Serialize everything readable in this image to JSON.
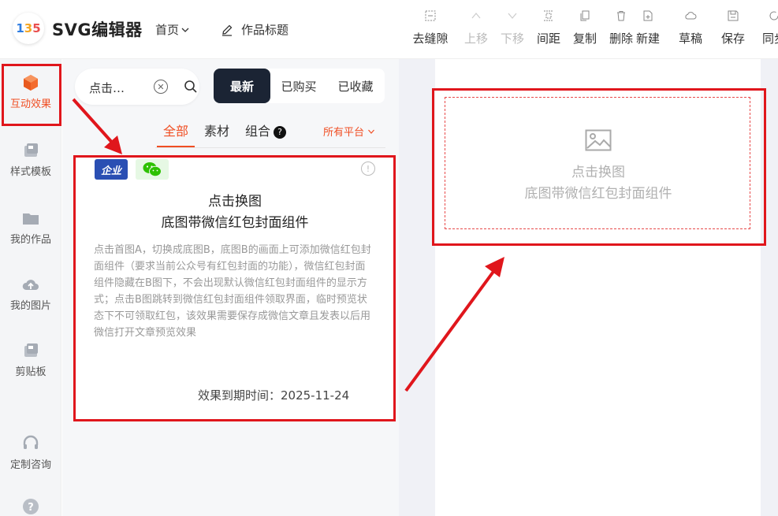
{
  "header": {
    "logo_letters": [
      "1",
      "3",
      "5"
    ],
    "app_title": "SVG编辑器",
    "home_menu": "首页",
    "work_title": "作品标题",
    "tools": [
      {
        "label": "去缝隙",
        "icon": "gap-icon",
        "disabled": false
      },
      {
        "label": "上移",
        "icon": "arrow-up-icon",
        "disabled": true
      },
      {
        "label": "下移",
        "icon": "arrow-down-icon",
        "disabled": true
      },
      {
        "label": "间距",
        "icon": "spacing-icon",
        "disabled": false
      },
      {
        "label": "复制",
        "icon": "copy-icon",
        "disabled": false
      },
      {
        "label": "删除",
        "icon": "trash-icon",
        "disabled": false
      },
      {
        "label": "新建",
        "icon": "new-file-icon",
        "disabled": false
      },
      {
        "label": "草稿",
        "icon": "cloud-icon",
        "disabled": false
      },
      {
        "label": "保存",
        "icon": "save-icon",
        "disabled": false
      },
      {
        "label": "同步",
        "icon": "sync-icon",
        "disabled": false
      }
    ]
  },
  "sidebar": {
    "items": [
      {
        "label": "互动效果",
        "icon": "cube-icon",
        "active": true
      },
      {
        "label": "样式模板",
        "icon": "template-icon",
        "active": false
      },
      {
        "label": "我的作品",
        "icon": "folder-icon",
        "active": false
      },
      {
        "label": "我的图片",
        "icon": "cloud-upload-icon",
        "active": false
      },
      {
        "label": "剪贴板",
        "icon": "clipboard-icon",
        "active": false
      },
      {
        "label": "定制咨询",
        "icon": "headset-icon",
        "active": false
      },
      {
        "label": "",
        "icon": "help-icon",
        "active": false
      }
    ]
  },
  "panel": {
    "search_value": "点击…",
    "sort": [
      "最新",
      "已购买",
      "已收藏"
    ],
    "tabs": [
      "全部",
      "素材",
      "组合"
    ],
    "platform": "所有平台",
    "card": {
      "badge_enterprise": "企业",
      "title_line1": "点击换图",
      "title_line2": "底图带微信红包封面组件",
      "description": "点击首图A，切换成底图B，底图B的画面上可添加微信红包封面组件（要求当前公众号有红包封面的功能），微信红包封面组件隐藏在B图下，不会出现默认微信红包封面组件的显示方式；点击B图跳转到微信红包封面组件领取界面，临时预览状态下不可领取红包，该效果需要保存成微信文章且发表以后用微信打开文章预览效果",
      "expire": "效果到期时间：2025-11-24"
    }
  },
  "canvas": {
    "component_line1": "点击换图",
    "component_line2": "底图带微信红包封面组件"
  },
  "colors": {
    "accent": "#f04e23",
    "highlight": "#e0161c",
    "dark_button": "#1b2434"
  }
}
